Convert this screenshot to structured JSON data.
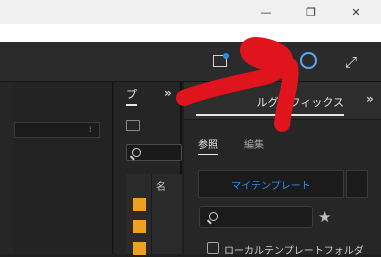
{
  "window": {
    "minimize_icon": "minimize-icon",
    "restore_icon": "restore-icon",
    "close_icon": "close-icon",
    "minimize_glyph": "—",
    "restore_glyph": "❐",
    "close_glyph": "✕"
  },
  "header": {
    "icons": [
      "screen-icon",
      "progress-icon",
      "expand-icon"
    ],
    "expand_glyph": "⤢"
  },
  "project_panel": {
    "tab_label": "プ",
    "chevron": "»",
    "column_name": "名",
    "item_color": "#f0a020"
  },
  "essential_graphics": {
    "tab_label": "ルグラフィックス",
    "chevron": "»",
    "tabs": {
      "browse": "参照",
      "edit": "編集"
    },
    "my_templates_button": "マイテンプレート",
    "star_glyph": "★",
    "local_templates_label": "ローカルテンプレートフォルダ"
  },
  "colors": {
    "accent_blue": "#2d8ceb",
    "annotation_red": "#e0141c"
  }
}
